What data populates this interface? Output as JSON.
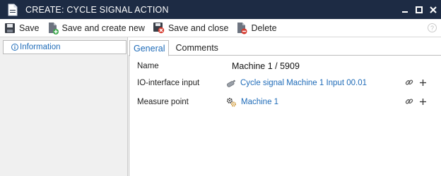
{
  "window": {
    "title": "CREATE: CYCLE SIGNAL ACTION"
  },
  "toolbar": {
    "save_label": "Save",
    "save_create_label": "Save and create new",
    "save_close_label": "Save and close",
    "delete_label": "Delete",
    "help_label": "?"
  },
  "sidebar": {
    "items": [
      {
        "label": "Information",
        "icon": "info-icon"
      }
    ]
  },
  "tabs": [
    {
      "label": "General",
      "active": true
    },
    {
      "label": "Comments",
      "active": false
    }
  ],
  "fields": {
    "name": {
      "label": "Name",
      "value": "Machine 1 / 5909"
    },
    "io_input": {
      "label": "IO-interface input",
      "value": "Cycle signal Machine 1 Input 00.01",
      "icon": "sensor-icon"
    },
    "measure_point": {
      "label": "Measure point",
      "value": "Machine 1",
      "icon": "gears-icon"
    }
  },
  "colors": {
    "titlebar": "#1d2b44",
    "link": "#1e6bb8",
    "delete": "#d63b2f",
    "add_green": "#3aa74a"
  }
}
